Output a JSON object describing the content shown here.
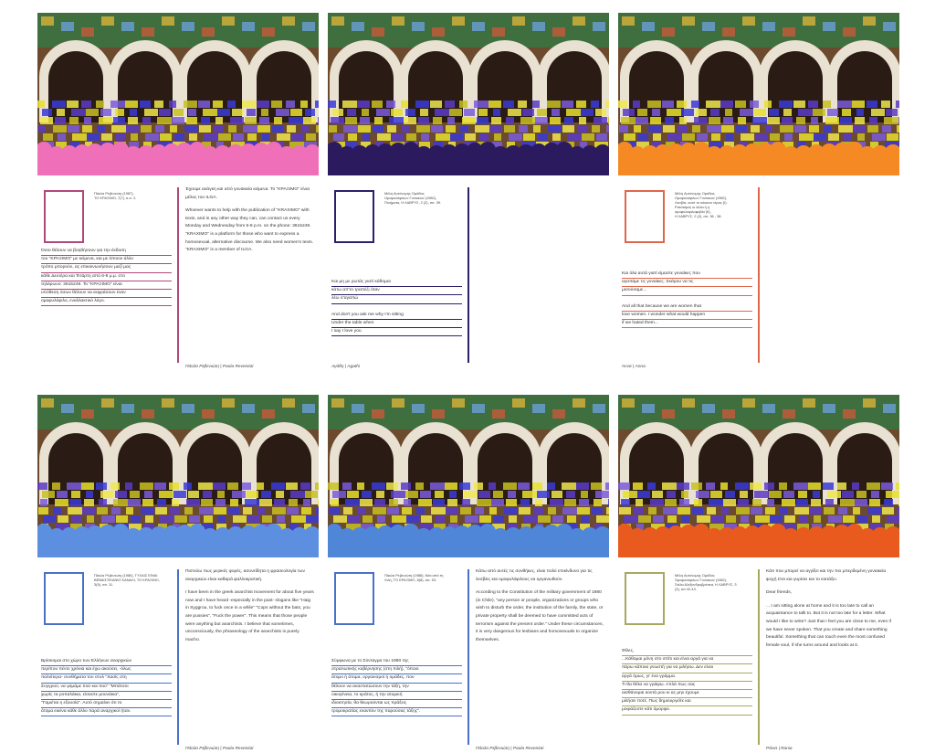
{
  "cards": [
    {
      "accent": "#b0487c",
      "crowd": "#f06fb9",
      "address": [
        "Πάολα Ρεβενιώτη (1987),",
        "ΤΟ ΚΡΑΞΙΜΟ, 7(7), σ.σ. 2."
      ],
      "left_lines": [
        "Όσοι θέλουν να βοηθήσουν για την έκδοση",
        "του \"ΚΡΑΞΙΜΟ\" με κείμενα, και με όποιον άλλο",
        "τρόπο μπορούν, ας επικοινωνήσουν μαζί μας",
        "κάθε Δευτέρα και Τετάρτη από 6-8 μ.μ. στο",
        "τηλέφωνο: 3615249. Το \"ΚΡΑΞΙΜΟ\" είναι",
        "υπόθεση όσων θέλουν να εκφράσουν έναν",
        "ομοφυλόφιλο, εναλλακτικό λόγο."
      ],
      "right_paragraphs": [
        "Έχουμε ανάγκη και από γυναικεία κείμενα. Το \"ΚΡΑΞΙΜΟ\" είναι μέλος του ILGA.",
        "Whoever wants to help with the publication of \"KRAXIMO\" with texts, and in any other way they can, can contact us every Monday and Wednesday from 6-8 p.m. on the phone: 3615249. \"KRAXIMO\" is a platform for those who want to express a homosexual, alternative discourse. We also need women's texts. \"KRAXIMO\" is a member of ILGA."
      ],
      "signature": "Πάολα Ρεβενιώτη | Paola Revenioti"
    },
    {
      "accent": "#2a2268",
      "crowd": "#2b1a5e",
      "address": [
        "Μέλη Αυτόνομης Ομάδας",
        "Ομοφυλόφιλων Γυναικών (1982),",
        "Ποιήματα, Η ΛΑΒΡΥΣ, 2 (2), σσ. 39."
      ],
      "left_lines": [
        "Και μη με ρωτάς γιατί κάθομαι",
        "κάτω απ'το τραπέζι όταν",
        "λέω σ'αγαπώ",
        "",
        "And don't you ask me why I'm sitting",
        "Under the table when",
        "I say I love you"
      ],
      "right_paragraphs": [],
      "signature": "Αγάθη | Agathi"
    },
    {
      "accent": "#e0664a",
      "crowd": "#f58a25",
      "address": [
        "Μέλη Αυτόνομης Ομάδας",
        "Ομοφυλόφιλων Γυναικών (1982),",
        "Λεσβία, αυτό το κόκκινο τέρας (Ι).",
        "Ρατσισμός κι άλλα ή η",
        "ομοφυλοφιλοφοβία (ΙΙ),",
        "Η ΛΑΒΡΥΣ, 2 (2), σσ. 36 - 38."
      ],
      "left_lines": [
        "Και όλα αυτά γιατί είμαστε γυναίκες που",
        "αγαπάμε τις γυναίκες. Σκέψου να τις",
        "μισούσαμε...",
        "",
        "And all that because we are women that",
        "love women. I wonder what would happen",
        "if we hated them..."
      ],
      "right_paragraphs": [],
      "signature": "Άννα | Anna"
    },
    {
      "accent": "#4a70c8",
      "crowd": "#5d8fe0",
      "address": [
        "Πάολα Ρεβενιώτη (1980), ΤΥΧΑΙΣ ΕΙΝΑΙ",
        "ΒΕΒΑΙΣΤΙΚΑΝΙΟ ΚΑΝΑΛΙ, ΤΟ ΚΡΑΞΙΜΟ,",
        "3(5), σσ. 11."
      ],
      "left_lines": [
        "Βρίσκομαι στο χώρο των Ελλήνων αναρχικών",
        "περίπου πέντε χρόνια και έχω ακούσει, -όλως",
        "παλιότερα- συνθήματα του στυλ \"Χασίς στη",
        "Συγγρού, να γαμάμε πού και πού\" \"Μπάτσοι",
        "χωρίς τα ροπαλάκια, είσαστε μουνάκια\",",
        "\"Γαμιέται η εξουσία\". Αυτό σημαίνει ότι το",
        "άτομα εκείνα κάθε άλλο παρά αναρχικοί ήταν."
      ],
      "right_paragraphs": [
        "Πιστεύω πως μερικές φορές, ασυνείδητα η φρασεολογία των αναρχικών είναι καθαρά φαλλοκρατική.",
        "I have been in the greek anarchist movement for about five years now and I have heard -especially in the past- slogans like \"Haig in Syggrou, to fuck once in a while\" \"Cops without the bats, you are pussies\", \"Fuck the power\". This means that those people were anything but anarchists. I believe that sometimes, unconsciously, the phraseology of the anarchists is purely macho."
      ],
      "signature": "Πάολα Ρεβενιώτη | Paola Revenioti"
    },
    {
      "accent": "#4a70c8",
      "crowd": "#4f86d8",
      "address": [
        "Πάολα Ρεβενιώτη (1988), Νέα από τη",
        "Χιλή, ΤΟ ΚΡΑΞΙΜΟ, 8(8), σσ. 53."
      ],
      "left_lines": [
        "Σύμφωνα με το Σύνταγμα του 1980 της",
        "στρατιωτικής κυβέρνησης (στη Χιλή), \"όποιο",
        "άτομο ή άτομα, οργανισμοί ή ομάδες, που",
        "θέλουν να αναστατώσουν την τάξη, την",
        "οικογένεια, το κράτος, ή την ατομική",
        "ιδιοκτησία, θα θεωρούνται ως πράξεις",
        "τρομοκρατίας εναντίον της παρούσας τάξης\"."
      ],
      "right_paragraphs": [
        "Κάτω από αυτές τις συνθήκες, είναι πολύ επικίνδυνο για τις λεσβίες και ομοφυλόφιλους να οργανωθούν.",
        "According to the Constitution of the military government of 1980 (in Chile), \"any person or people, organizations or groups who wish to disturb the order, the institution of the family, the state, or private property shall be deemed to have committed acts of terrorism against the present order.\" Under these circumstances, it is very dangerous for lesbians and homosexuals to organize themselves."
      ],
      "signature": "Πάολα Ρεβενιώτη | Paola Revenioti"
    },
    {
      "accent": "#a8a860",
      "crowd": "#e85a1e",
      "address": [
        "Μέλη Αυτόνομης Ομάδας",
        "Ομοφυλόφιλων Γυναικών (1982),",
        "Στέλα Αλεξανδροβρέπεα, Η ΛΑΒΡΥΣ, 3",
        "(3), σσ 42-43."
      ],
      "left_lines": [
        "Φίλες,",
        "...Κάθομαι μόνη στο σπίτι και είναι αργά για να",
        "πάρω κάποια γνωστή για να μιλήσω. Δεν είναι",
        "αργά όμως, γι' ένα γράμμα.",
        "Τι θα θέλα να γράψω. Απλά πως σας",
        "αισθάνομαι κοντά μου κι ας μην έχουμε",
        "μιλήσει ποτέ. Πως δημιουργείτε και",
        "μοιράζεστε κάτι όμορφο."
      ],
      "right_paragraphs": [
        "Κάτι που μπορεί να αγγίξει και την πιο μπερδεμένη γυναικεία ψυχή έτσι και γυρίσει και το κοιτάξει.",
        "Dear friends,",
        "... I am sitting alone at home and it is too late to call an acquaintance to talk to. But it is not too late for a letter. What would I like to write? Just that I feel you are close to me, even if we have never spoken. That you create and share something beautiful. Something that can touch even the most confused female soul, if she turns around and looks at it."
      ],
      "signature": "Ράνια | Rania"
    }
  ]
}
